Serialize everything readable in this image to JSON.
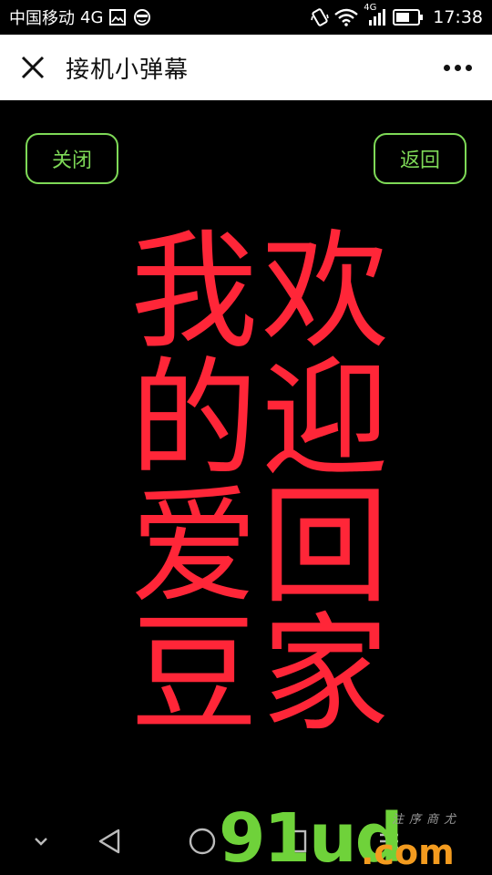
{
  "status_bar": {
    "carrier": "中国移动",
    "network": "4G",
    "signal_label": "4G",
    "time": "17:38",
    "icons": [
      "image-icon",
      "face-icon",
      "vibrate-icon",
      "wifi-icon",
      "signal-icon",
      "battery-icon"
    ]
  },
  "title_bar": {
    "title": "接机小弹幕",
    "close_icon": "close-icon",
    "more_icon": "more-icon"
  },
  "content": {
    "close_button": "关闭",
    "back_button": "返回",
    "banner_right": "欢迎回家",
    "banner_left": "我的爱豆",
    "accent_color": "#7ed957",
    "text_color": "#ff2638"
  },
  "nav_bar": {
    "icons": [
      "chevron-down-icon",
      "back-triangle-icon",
      "home-circle-icon",
      "recents-square-icon",
      "menu-icon"
    ]
  },
  "watermark": {
    "main": "91ud",
    "suffix": ".com",
    "tagline": "注序商尤"
  }
}
